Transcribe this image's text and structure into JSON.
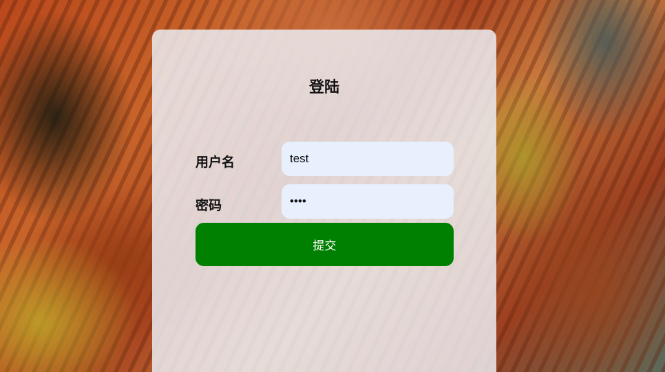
{
  "login": {
    "title": "登陆",
    "username_label": "用户名",
    "username_value": "test",
    "password_label": "密码",
    "password_value": "test",
    "submit_label": "提交"
  },
  "colors": {
    "submit_button": "#008000",
    "input_background": "#e8f0fe",
    "panel_background": "rgba(235,235,240,0.86)"
  }
}
